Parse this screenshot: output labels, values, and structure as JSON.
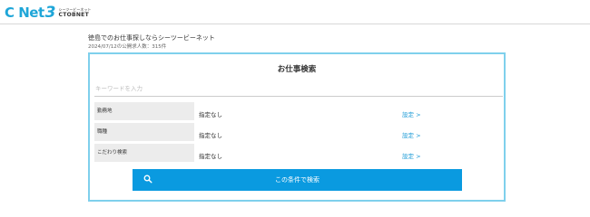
{
  "header": {
    "logo": {
      "mark": "C Net",
      "number": "3",
      "kana": "シーツービーネット",
      "en": "CTOBNET"
    }
  },
  "site": {
    "title": "徳島でのお仕事探しならシーツービーネット",
    "subtitle": "2024/07/12の公開求人数：315件"
  },
  "search": {
    "title": "お仕事検索",
    "keyword_placeholder": "キーワードを入力",
    "keyword_value": "",
    "rows": [
      {
        "label": "勤務地",
        "value": "指定なし",
        "link": "設定 >"
      },
      {
        "label": "職種",
        "value": "指定なし",
        "link": "設定 >"
      },
      {
        "label": "こだわり検索",
        "value": "指定なし",
        "link": "設定 >"
      }
    ],
    "submit_label": "この条件で検索",
    "submit_icon": "search-icon"
  },
  "colors": {
    "brand": "#1fa6d8",
    "panel_border": "#7fd0ec",
    "button": "#0a9ae0",
    "link": "#1a9ad6"
  }
}
